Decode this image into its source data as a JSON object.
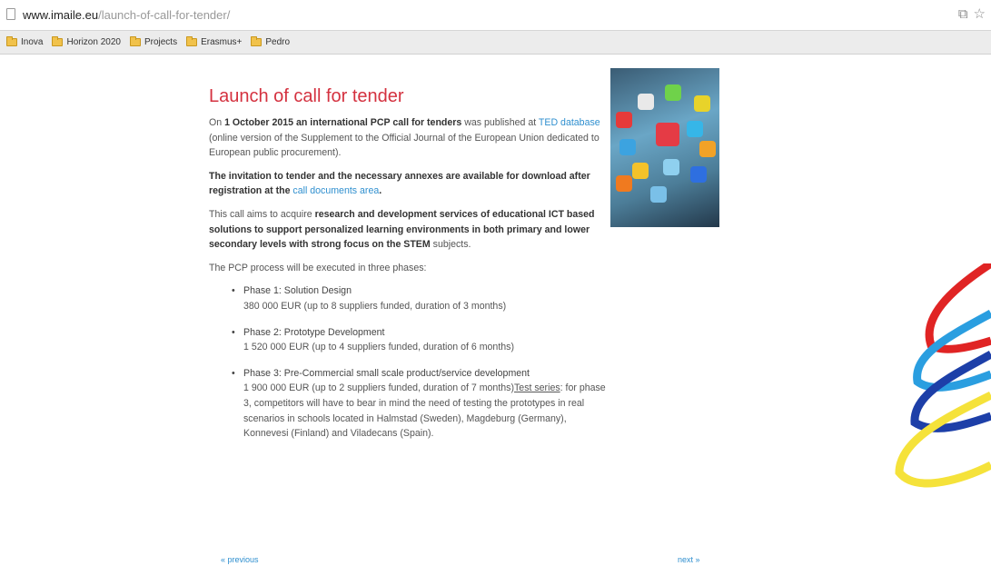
{
  "browser": {
    "url_domain": "www.imaile.eu",
    "url_path": "/launch-of-call-for-tender/",
    "bookmarks": [
      "Inova",
      "Horizon 2020",
      "Projects",
      "Erasmus+",
      "Pedro"
    ]
  },
  "article": {
    "title": "Launch of call for tender",
    "p1": {
      "t1": "On ",
      "b1": "1 October 2015",
      "b2": " an international PCP call for tenders",
      "t2": " was published at ",
      "link": "TED database",
      "t3": " (online version of the Supplement to the Official Journal of the European Union dedicated to European public procurement)."
    },
    "p2": {
      "b1": "The invitation to tender and the necessary annexes are available for download after registration at the ",
      "link": "call documents area",
      "t1": "."
    },
    "p3": {
      "t1": "This call aims to acquire ",
      "b1": "research and development services of educational ICT based solutions to support personalized learning environments in both primary and lower secondary levels with strong focus on the STEM",
      "t2": " subjects."
    },
    "p4": "The PCP process will be executed in three phases:",
    "phases": [
      {
        "name": "Phase 1: Solution Design",
        "detail": "380 000 EUR (up to 8 suppliers funded, duration of 3 months)"
      },
      {
        "name": "Phase 2: Prototype Development",
        "detail": "1 520 000 EUR (up to 4 suppliers funded, duration of 6 months)"
      },
      {
        "name": "Phase 3: Pre-Commercial small scale product/service development",
        "detail": "1 900 000 EUR (up to 2 suppliers funded, duration of 7 months)",
        "underlined": "Test series",
        "detail2": ": for phase 3, competitors will have to bear in mind the need of testing the prototypes in real scenarios in schools located in Halmstad (Sweden), Magdeburg (Germany), Konnevesi (Finland) and Viladecans (Spain)."
      }
    ]
  },
  "nav": {
    "previous": "« previous",
    "next": "next »"
  },
  "colors": {
    "title": "#d4313f",
    "link": "#2f8fcf"
  }
}
